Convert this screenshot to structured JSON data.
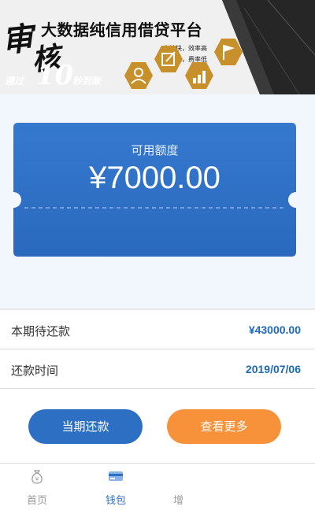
{
  "banner": {
    "title": "大数据纯信用借贷平台",
    "subtitle_1": "审核快，效率高",
    "subtitle_2": "额度高，费率低",
    "calligraphy_1": "审",
    "calligraphy_2": "核",
    "tag_prefix": "通过",
    "tag_number": "10",
    "tag_suffix": "秒到账",
    "icons": [
      "user-icon",
      "edit-icon",
      "flag-icon",
      "chart-icon"
    ]
  },
  "card": {
    "label": "可用额度",
    "amount": "¥7000.00"
  },
  "rows": {
    "due_label": "本期待还款",
    "due_value": "¥43000.00",
    "date_label": "还款时间",
    "date_value": "2019/07/06"
  },
  "buttons": {
    "repay": "当期还款",
    "more": "查看更多"
  },
  "tabs": {
    "home": "首页",
    "wallet": "钱包",
    "third": "增"
  },
  "colors": {
    "card_blue": "#2e72c8",
    "accent_blue": "#1e69b8",
    "orange": "#f7923a",
    "gold": "#c7902a"
  }
}
